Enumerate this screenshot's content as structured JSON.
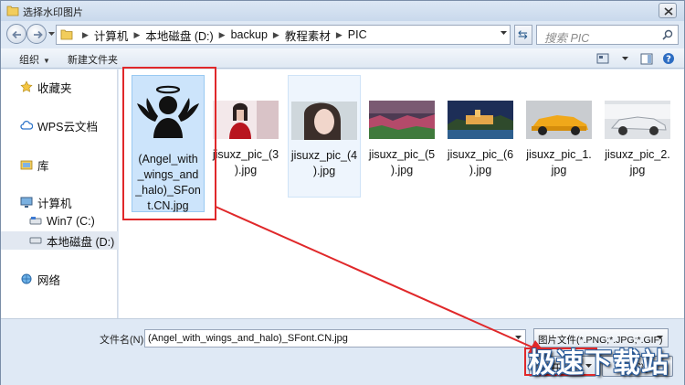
{
  "window": {
    "title": "选择水印图片",
    "close_label": "✕"
  },
  "address": {
    "crumbs": [
      "计算机",
      "本地磁盘 (D:)",
      "backup",
      "教程素材",
      "PIC"
    ],
    "search_placeholder": "搜索 PIC"
  },
  "toolbar": {
    "organize_label": "组织",
    "new_folder_label": "新建文件夹"
  },
  "sidebar": {
    "items": [
      {
        "label": "收藏夹",
        "icon": "star-icon"
      },
      {
        "label": "WPS云文档",
        "icon": "cloud-icon"
      },
      {
        "label": "库",
        "icon": "library-icon"
      },
      {
        "label": "计算机",
        "icon": "computer-icon"
      },
      {
        "label": "Win7 (C:)",
        "icon": "drive-icon"
      },
      {
        "label": "本地磁盘 (D:)",
        "icon": "drive-icon"
      },
      {
        "label": "网络",
        "icon": "network-icon"
      }
    ]
  },
  "files": [
    {
      "name": "(Angel_with_wings_and_halo)_SFont.CN.jpg",
      "display": "(Angel_with\n_wings_and\n_halo)_SFon\nt.CN.jpg",
      "selected": true
    },
    {
      "name": "jisuxz_pic_(3).jpg",
      "display": "jisuxz_pic_(3\n).jpg"
    },
    {
      "name": "jisuxz_pic_(4).jpg",
      "display": "jisuxz_pic_(4\n).jpg",
      "hover": true
    },
    {
      "name": "jisuxz_pic_(5).jpg",
      "display": "jisuxz_pic_(5\n).jpg"
    },
    {
      "name": "jisuxz_pic_(6).jpg",
      "display": "jisuxz_pic_(6\n).jpg"
    },
    {
      "name": "jisuxz_pic_1.jpg",
      "display": "jisuxz_pic_1.\njpg"
    },
    {
      "name": "jisuxz_pic_2.jpg",
      "display": "jisuxz_pic_2.\njpg"
    }
  ],
  "bottom": {
    "filename_label": "文件名(N):",
    "filename_value": "(Angel_with_wings_and_halo)_SFont.CN.jpg",
    "filetype_value": "图片文件(*.PNG;*.JPG;*.GIF)",
    "open_label": "打开",
    "cancel_label": "取消"
  },
  "watermark": "极速下载站",
  "colors": {
    "highlight": "#e0282a",
    "selected_bg": "#cce4fb"
  }
}
